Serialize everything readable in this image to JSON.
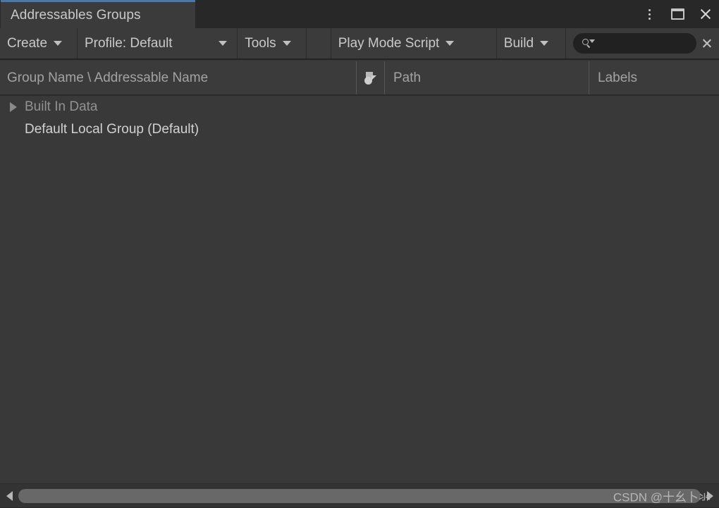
{
  "window": {
    "tab_title": "Addressables Groups",
    "controls": {
      "menu": "⋮",
      "maximize": "maximize",
      "close": "×"
    }
  },
  "toolbar": {
    "create_label": "Create",
    "profile_label": "Profile: Default",
    "tools_label": "Tools",
    "play_mode_script_label": "Play Mode Script",
    "build_label": "Build",
    "search": {
      "value": "",
      "placeholder": ""
    }
  },
  "columns": [
    {
      "key": "name",
      "label": "Group Name \\ Addressable Name"
    },
    {
      "key": "icon",
      "label": ""
    },
    {
      "key": "path",
      "label": "Path"
    },
    {
      "key": "labels",
      "label": "Labels"
    }
  ],
  "tree": {
    "rows": [
      {
        "label": "Built In Data",
        "expandable": true,
        "expanded": false,
        "dimmed": true,
        "path": "",
        "labels": ""
      },
      {
        "label": "Default Local Group (Default)",
        "expandable": false,
        "expanded": false,
        "dimmed": false,
        "path": "",
        "labels": ""
      }
    ]
  },
  "statusbar": {
    "watermark": "CSDN @十幺卜氺"
  },
  "colors": {
    "tab_accent": "#4a77a8",
    "panel_bg": "#393939",
    "toolbar_bg": "#3b3b3b",
    "titlebar_bg": "#282828",
    "text_primary": "#c9c9c9",
    "text_dim": "#929292",
    "scrollbar_thumb": "#686868"
  }
}
